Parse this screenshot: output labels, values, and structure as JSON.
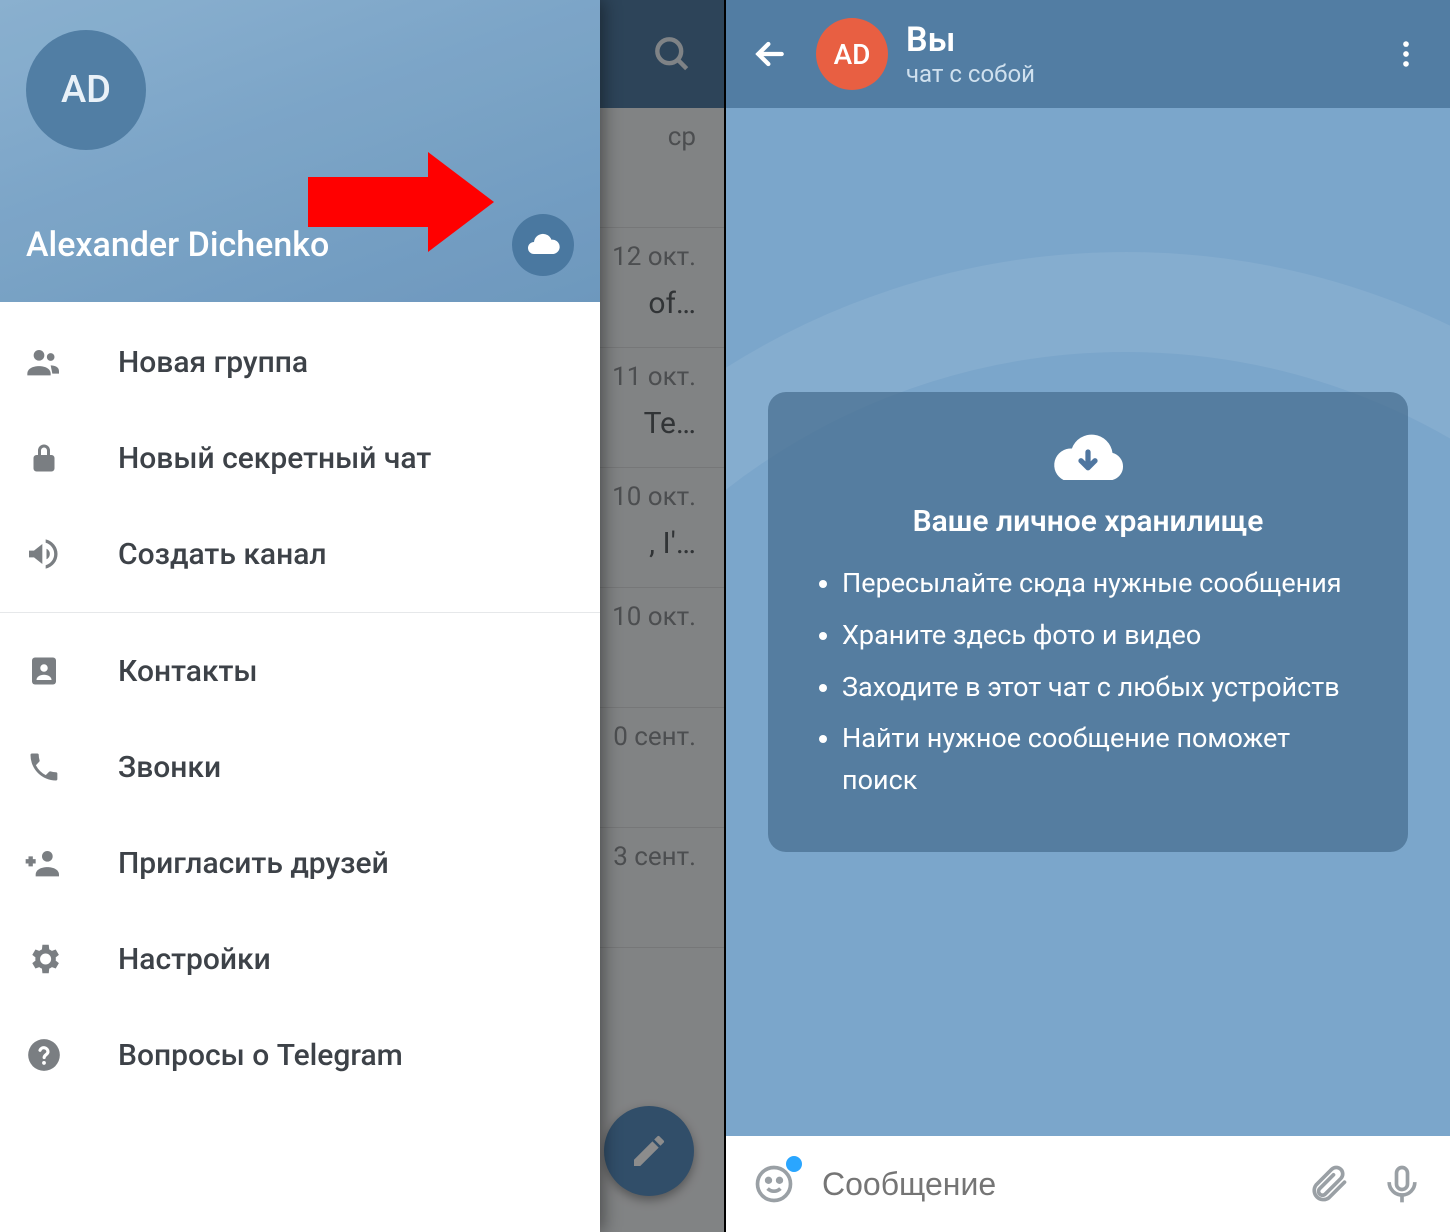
{
  "left": {
    "avatar_initials": "AD",
    "user_name": "Alexander Dichenko",
    "menu": [
      {
        "icon": "group-icon",
        "label": "Новая группа"
      },
      {
        "icon": "lock-icon",
        "label": "Новый секретный чат"
      },
      {
        "icon": "megaphone-icon",
        "label": "Создать канал"
      },
      {
        "icon": "contacts-icon",
        "label": "Контакты"
      },
      {
        "icon": "phone-icon",
        "label": "Звонки"
      },
      {
        "icon": "invite-icon",
        "label": "Пригласить друзей"
      },
      {
        "icon": "gear-icon",
        "label": "Настройки"
      },
      {
        "icon": "help-icon",
        "label": "Вопросы о Telegram"
      }
    ],
    "bg_rows": [
      {
        "time": "ср",
        "snippet": ""
      },
      {
        "time": "12 окт.",
        "snippet": "of…"
      },
      {
        "time": "11 окт.",
        "snippet": "Те…"
      },
      {
        "time": "10 окт.",
        "snippet": ", I'…"
      },
      {
        "time": "10 окт.",
        "snippet": ""
      },
      {
        "time": "0 сент.",
        "snippet": ""
      },
      {
        "time": "3 сент.",
        "snippet": ""
      }
    ]
  },
  "right": {
    "avatar_initials": "AD",
    "title": "Вы",
    "subtitle": "чат с собой",
    "storage": {
      "title": "Ваше личное хранилище",
      "items": [
        "Пересылайте сюда нужные сообщения",
        "Храните здесь фото и видео",
        "Заходите в этот чат с любых устройств",
        "Найти нужное сообщение поможет поиск"
      ]
    },
    "input_placeholder": "Сообщение"
  },
  "colors": {
    "header": "#527da3",
    "accent_red": "#ff0000",
    "avatar_orange": "#e85f42",
    "bg_chat": "#7ba6cb"
  }
}
